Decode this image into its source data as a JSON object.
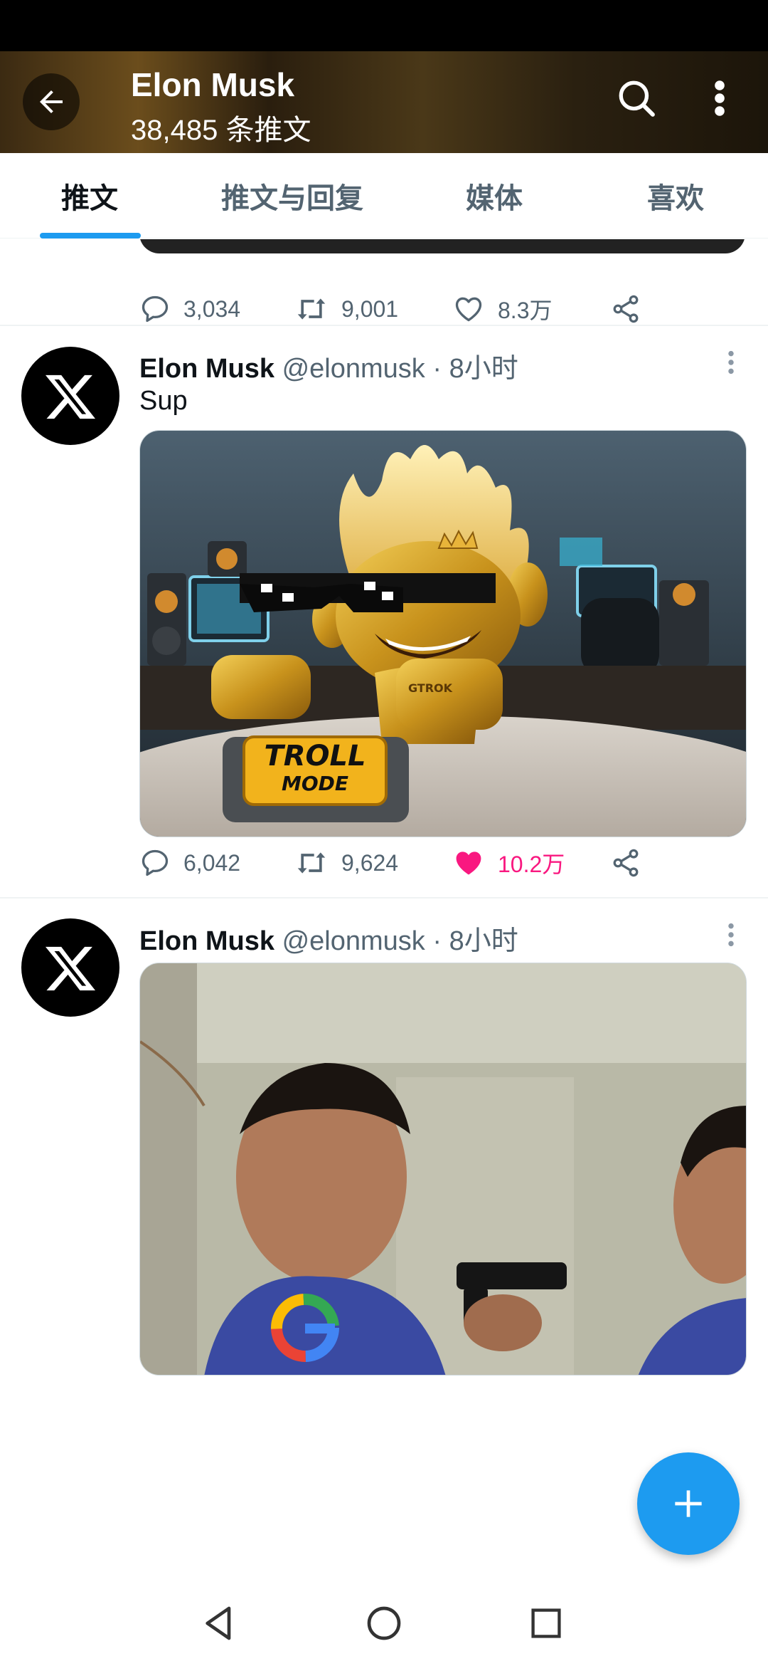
{
  "header": {
    "title": "Elon Musk",
    "subtitle": "38,485 条推文",
    "back_icon": "arrow-left-icon",
    "search_icon": "search-icon",
    "more_icon": "more-vertical-icon"
  },
  "tabs": [
    {
      "label": "推文",
      "active": true
    },
    {
      "label": "推文与回复",
      "active": false
    },
    {
      "label": "媒体",
      "active": false
    },
    {
      "label": "喜欢",
      "active": false
    }
  ],
  "previous_tweet": {
    "replies": "3,034",
    "retweets": "9,001",
    "likes": "8.3万"
  },
  "tweets": [
    {
      "name": "Elon Musk",
      "handle": "@elonmusk",
      "time": "· 8小时",
      "text": "Sup",
      "media_text": {
        "line1": "TROLL",
        "line2": "MODE",
        "badge": "GTROK"
      },
      "replies": "6,042",
      "retweets": "9,624",
      "likes": "10.2万",
      "liked": true
    },
    {
      "name": "Elon Musk",
      "handle": "@elonmusk",
      "time": "· 8小时"
    }
  ],
  "colors": {
    "accent": "#1d9bf0",
    "like": "#f91880",
    "muted": "#536471"
  }
}
